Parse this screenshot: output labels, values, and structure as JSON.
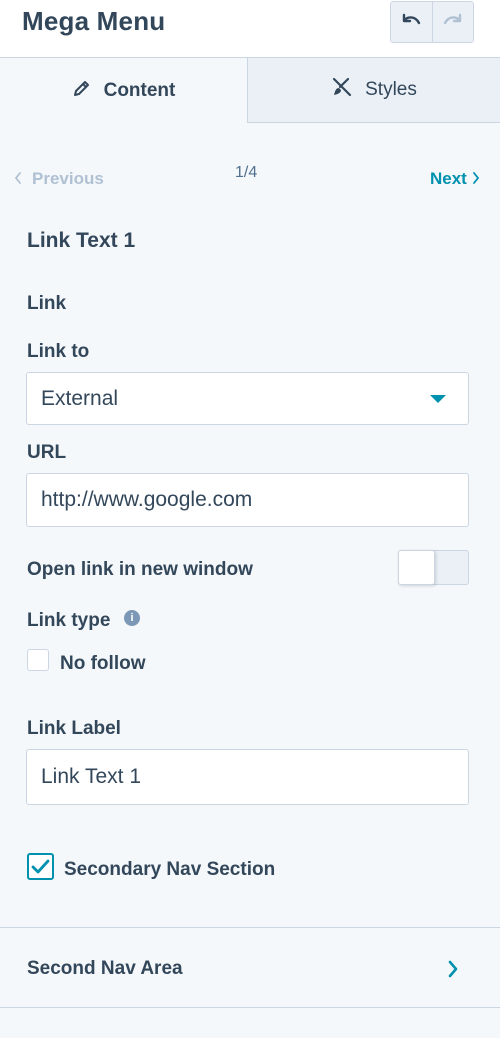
{
  "header": {
    "title": "Mega Menu",
    "undo_icon": "undo-icon",
    "redo_icon": "redo-icon"
  },
  "tabs": [
    {
      "label": "Content",
      "icon": "pencil-icon",
      "active": true
    },
    {
      "label": "Styles",
      "icon": "brush-icon",
      "active": false
    }
  ],
  "pager": {
    "previous": "Previous",
    "count": "1/4",
    "next": "Next"
  },
  "form": {
    "section_title": "Link Text 1",
    "link_heading": "Link",
    "link_to_label": "Link to",
    "link_to_value": "External",
    "url_label": "URL",
    "url_value": "http://www.google.com",
    "new_window_label": "Open link in new window",
    "new_window_on": false,
    "link_type_label": "Link type",
    "no_follow_label": "No follow",
    "no_follow_checked": false,
    "link_label_label": "Link Label",
    "link_label_value": "Link Text 1",
    "secondary_nav_label": "Secondary Nav Section",
    "secondary_nav_checked": true
  },
  "nav_row": {
    "label": "Second Nav Area"
  },
  "colors": {
    "accent": "#0091ae",
    "text": "#33475b",
    "border": "#cbd6e2",
    "background": "#f5f8fa",
    "muted": "#b0c1d4"
  }
}
